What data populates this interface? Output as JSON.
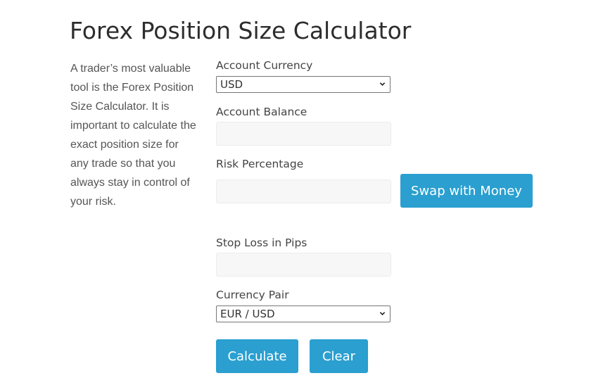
{
  "page": {
    "title": "Forex Position Size Calculator",
    "intro": "A trader’s most valuable tool is the Forex Position Size Calculator. It is important to calculate the exact position size for any trade so that you always stay in control of your risk."
  },
  "form": {
    "account_currency": {
      "label": "Account Currency",
      "value": "USD"
    },
    "account_balance": {
      "label": "Account Balance",
      "value": ""
    },
    "risk_percentage": {
      "label": "Risk Percentage",
      "value": ""
    },
    "stop_loss": {
      "label": "Stop Loss in Pips",
      "value": ""
    },
    "currency_pair": {
      "label": "Currency Pair",
      "value": "EUR / USD"
    }
  },
  "buttons": {
    "swap": "Swap with Money",
    "calculate": "Calculate",
    "clear": "Clear"
  },
  "colors": {
    "button": "#2a9fd0"
  }
}
